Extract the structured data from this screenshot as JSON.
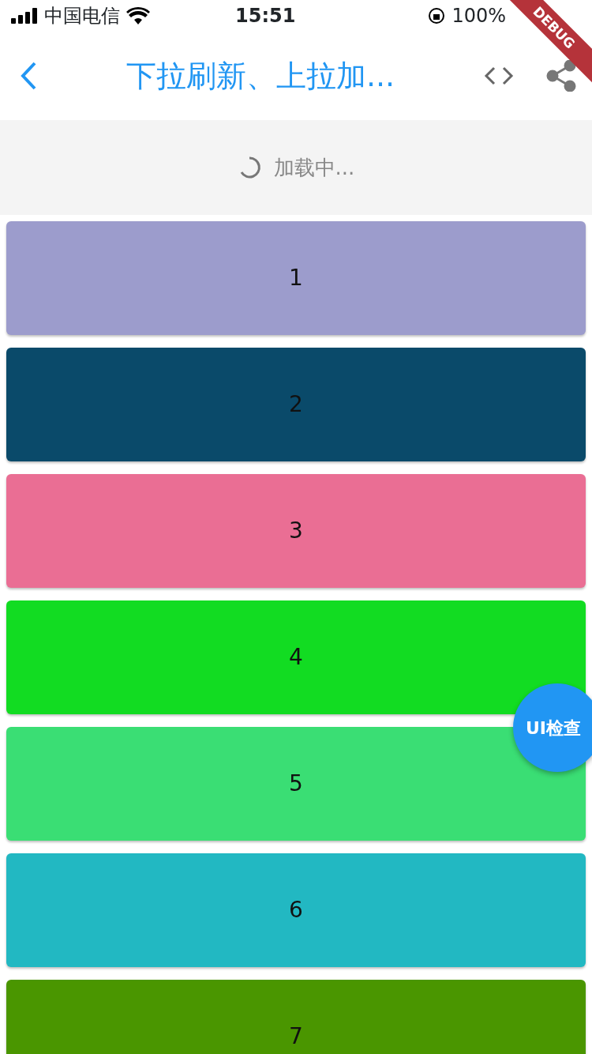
{
  "status_bar": {
    "carrier": "中国电信",
    "time": "15:51",
    "battery": "100%"
  },
  "app_bar": {
    "title": "下拉刷新、上拉加..."
  },
  "loader": {
    "text": "加载中..."
  },
  "cards": [
    {
      "label": "1",
      "color": "#9c9ccc"
    },
    {
      "label": "2",
      "color": "#0a4a6a"
    },
    {
      "label": "3",
      "color": "#ea6e94"
    },
    {
      "label": "4",
      "color": "#12dc22"
    },
    {
      "label": "5",
      "color": "#3ade74"
    },
    {
      "label": "6",
      "color": "#22b8c2"
    },
    {
      "label": "7",
      "color": "#4a9600"
    }
  ],
  "fab": {
    "label": "UI检查"
  },
  "debug_banner": {
    "label": "DEBUG"
  }
}
